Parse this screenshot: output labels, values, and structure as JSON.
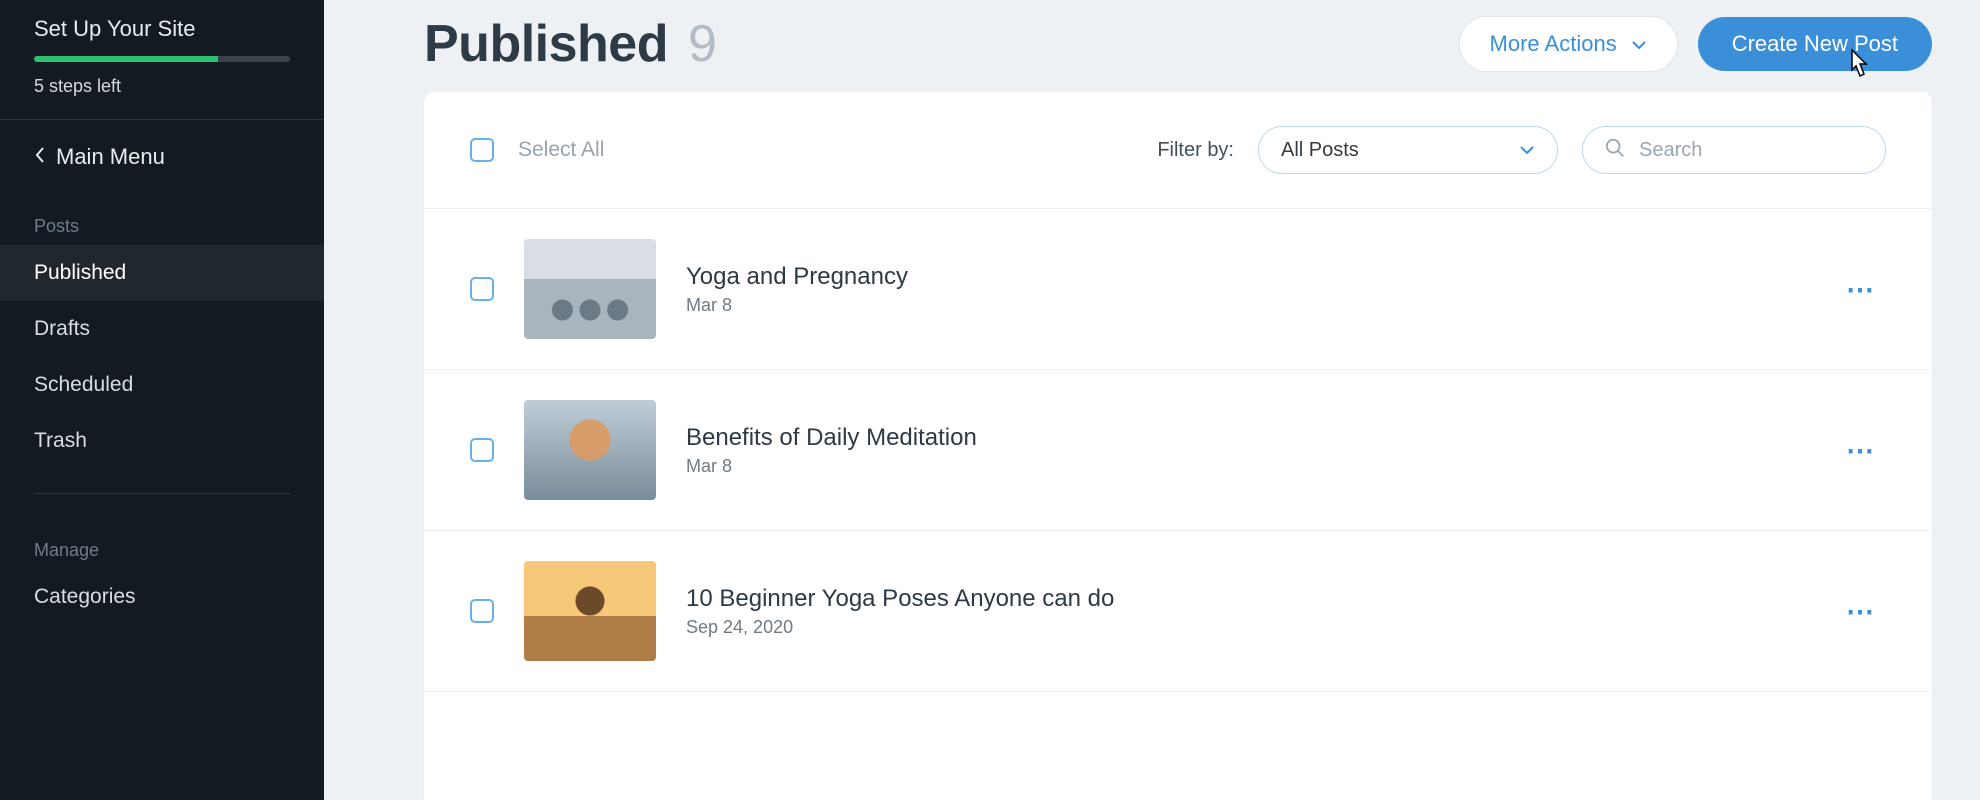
{
  "sidebar": {
    "setup_title": "Set Up Your Site",
    "steps_left": "5 steps left",
    "main_menu": "Main Menu",
    "posts_label": "Posts",
    "manage_label": "Manage",
    "nav": {
      "published": "Published",
      "drafts": "Drafts",
      "scheduled": "Scheduled",
      "trash": "Trash",
      "categories": "Categories"
    }
  },
  "header": {
    "title": "Published",
    "count": "9",
    "more_actions": "More Actions",
    "create_post": "Create New Post"
  },
  "controls": {
    "select_all": "Select All",
    "filter_by": "Filter by:",
    "filter_value": "All Posts",
    "search_placeholder": "Search"
  },
  "posts": [
    {
      "title": "Yoga and Pregnancy",
      "date": "Mar 8"
    },
    {
      "title": "Benefits of Daily Meditation",
      "date": "Mar 8"
    },
    {
      "title": "10 Beginner Yoga Poses Anyone can do",
      "date": "Sep 24, 2020"
    }
  ]
}
